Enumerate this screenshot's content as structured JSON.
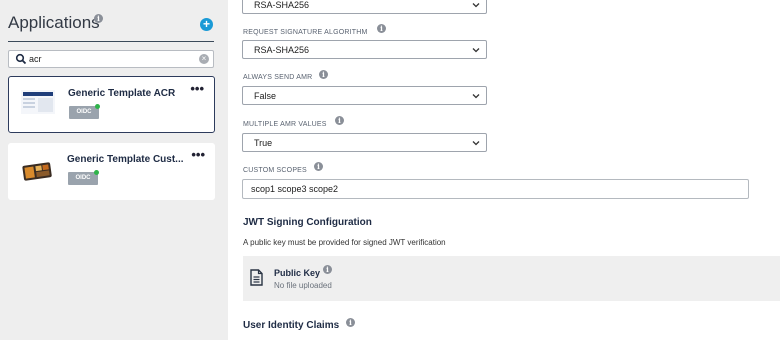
{
  "sidebar": {
    "title": "Applications",
    "add_label": "+",
    "search": {
      "value": "acr"
    },
    "apps": [
      {
        "name": "Generic Template ACR",
        "badge": "OIDC",
        "status_color": "#2fb34a",
        "selected": true
      },
      {
        "name": "Generic Template Cust...",
        "badge": "OIDC",
        "status_color": "#2fb34a",
        "selected": false
      }
    ],
    "more_label": "•••"
  },
  "form": {
    "top_select": {
      "value": "RSA-SHA256"
    },
    "request_signature_algorithm": {
      "label": "REQUEST SIGNATURE ALGORITHM",
      "value": "RSA-SHA256"
    },
    "always_send_amr": {
      "label": "ALWAYS SEND AMR",
      "value": "False"
    },
    "multiple_amr_values": {
      "label": "MULTIPLE AMR VALUES",
      "value": "True"
    },
    "custom_scopes": {
      "label": "CUSTOM SCOPES",
      "value": "scop1 scope3 scope2"
    }
  },
  "jwt": {
    "title": "JWT Signing Configuration",
    "helper": "A public key must be provided for signed JWT verification",
    "public_key_title": "Public Key",
    "public_key_status": "No file uploaded"
  },
  "claims": {
    "title": "User Identity Claims"
  },
  "icons": {
    "info": "info-icon",
    "search": "search-icon",
    "clear": "clear-icon",
    "chevron": "chevron-down-icon",
    "document": "document-icon"
  },
  "colors": {
    "accent": "#1a9ad6",
    "status": "#2fb34a",
    "navy": "#1e2b44"
  }
}
